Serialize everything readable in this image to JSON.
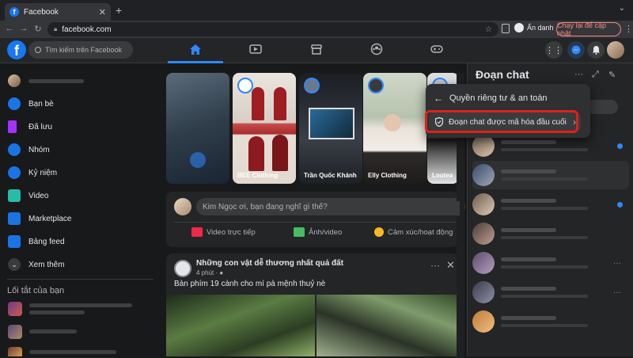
{
  "browser": {
    "tab_title": "Facebook",
    "url": "facebook.com",
    "profile_label": "Ẩn danh",
    "relaunch_label": "Chạy lại để cập nhật"
  },
  "header": {
    "logo_letter": "f",
    "search_placeholder": "Tìm kiếm trên Facebook"
  },
  "sidebar": {
    "items": [
      {
        "label": "Bạn bè",
        "color": "#1b74e4"
      },
      {
        "label": "Đã lưu",
        "color": "#a033ff"
      },
      {
        "label": "Nhóm",
        "color": "#1b74e4"
      },
      {
        "label": "Kỷ niệm",
        "color": "#1b74e4"
      },
      {
        "label": "Video",
        "color": "#2abba7"
      },
      {
        "label": "Marketplace",
        "color": "#1b74e4"
      },
      {
        "label": "Bảng feed",
        "color": "#1b74e4"
      },
      {
        "label": "Xem thêm",
        "color": "#3a3b3c"
      }
    ],
    "shortcuts_title": "Lối tắt của bạn"
  },
  "stories": [
    {
      "name": "BEE Clothing"
    },
    {
      "name": "Trần Quốc Khánh"
    },
    {
      "name": "Elly Clothing"
    },
    {
      "name": "Loutea"
    }
  ],
  "composer": {
    "placeholder": "Kim Ngọc ơi, bạn đang nghĩ gì thế?",
    "live_video": "Video trực tiếp",
    "photo_video": "Ảnh/video",
    "feeling": "Cảm xúc/hoạt động"
  },
  "post": {
    "group_name": "Những con vật dễ thương nhất quả đất",
    "time": "4 phút · ",
    "body": "Bàn phím 19 cành cho mí pà mệnh thuỷ nè"
  },
  "chat": {
    "title": "Đoạn chat",
    "privacy_menu": {
      "back_label": "Quyền riêng tư & an toàn",
      "item_label": "Đoạn chat được mã hóa đầu cuối"
    }
  },
  "colors": {
    "accent": "#2d88ff",
    "highlight": "#e0201a",
    "background": "#18191a"
  }
}
